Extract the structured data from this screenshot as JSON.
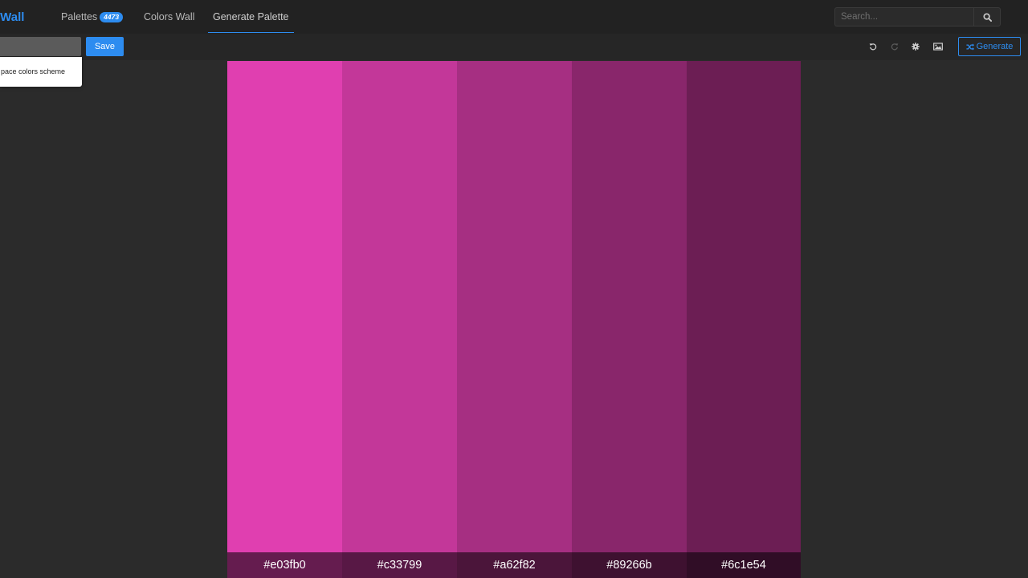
{
  "navbar": {
    "brand": "rsWall",
    "palettes_label": "Palettes",
    "palettes_count": "4473",
    "colors_wall_label": "Colors Wall",
    "generate_palette_label": "Generate Palette",
    "search_placeholder": "Search...",
    "search_icon": "search-icon",
    "accent_color": "#2d8cf0"
  },
  "toolbar": {
    "save_label": "Save",
    "generate_label": "Generate",
    "icons": [
      "undo-icon",
      "redo-icon",
      "settings-icon",
      "image-icon",
      "shuffle-icon"
    ]
  },
  "suggestion": {
    "text": "pace colors scheme"
  },
  "palette": {
    "colors": [
      {
        "hex": "#e03fb0",
        "label": "#e03fb0"
      },
      {
        "hex": "#c33799",
        "label": "#c33799"
      },
      {
        "hex": "#a62f82",
        "label": "#a62f82"
      },
      {
        "hex": "#89266b",
        "label": "#89266b"
      },
      {
        "hex": "#6c1e54",
        "label": "#6c1e54"
      }
    ]
  }
}
